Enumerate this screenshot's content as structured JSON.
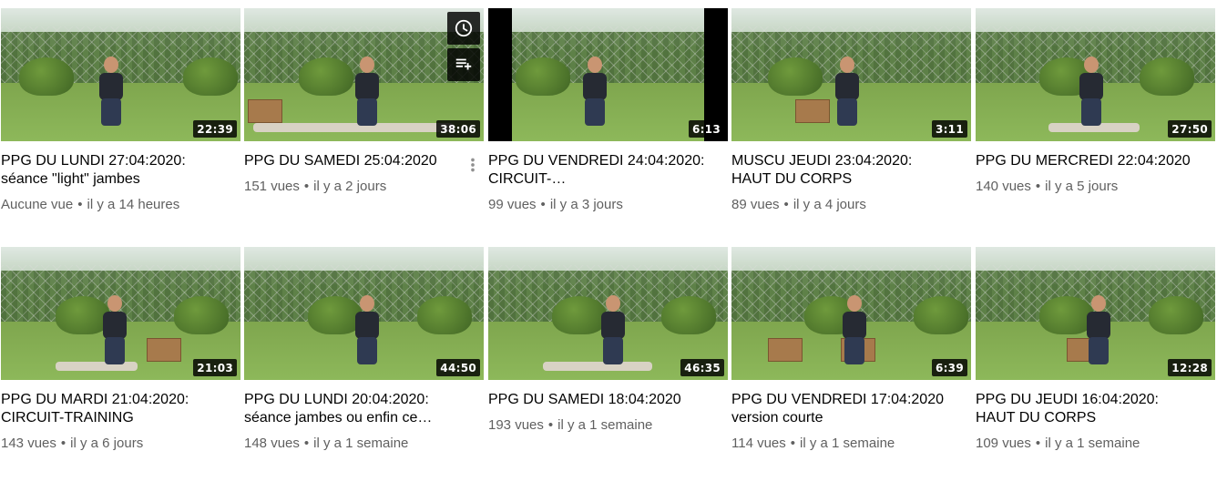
{
  "videos": [
    {
      "title": "PPG DU LUNDI 27:04:2020: séance \"light\" jambes",
      "views": "Aucune vue",
      "age": "il y a 14 heures",
      "duration": "22:39"
    },
    {
      "title": "PPG DU SAMEDI 25:04:2020",
      "views": "151 vues",
      "age": "il y a 2 jours",
      "duration": "38:06"
    },
    {
      "title": "PPG DU VENDREDI 24:04:2020: CIRCUIT-…",
      "views": "99 vues",
      "age": "il y a 3 jours",
      "duration": "6:13"
    },
    {
      "title": "MUSCU JEUDI 23:04:2020: HAUT DU CORPS",
      "views": "89 vues",
      "age": "il y a 4 jours",
      "duration": "3:11"
    },
    {
      "title": "PPG DU MERCREDI 22:04:2020",
      "views": "140 vues",
      "age": "il y a 5 jours",
      "duration": "27:50"
    },
    {
      "title": "PPG DU MARDI 21:04:2020: CIRCUIT-TRAINING",
      "views": "143 vues",
      "age": "il y a 6 jours",
      "duration": "21:03"
    },
    {
      "title": "PPG DU LUNDI 20:04:2020: séance jambes ou enfin ce…",
      "views": "148 vues",
      "age": "il y a 1 semaine",
      "duration": "44:50"
    },
    {
      "title": "PPG DU SAMEDI 18:04:2020",
      "views": "193 vues",
      "age": "il y a 1 semaine",
      "duration": "46:35"
    },
    {
      "title": "PPG DU VENDREDI 17:04:2020 version courte",
      "views": "114 vues",
      "age": "il y a 1 semaine",
      "duration": "6:39"
    },
    {
      "title": "PPG DU JEUDI 16:04:2020: HAUT DU CORPS",
      "views": "109 vues",
      "age": "il y a 1 semaine",
      "duration": "12:28"
    }
  ],
  "separator": "•",
  "hovered_index": 1,
  "hover_icons": [
    "clock-icon",
    "add-to-queue-icon",
    "more-vert-icon"
  ],
  "colors": {
    "duration_bg": "#000000cc",
    "meta_text": "#606060",
    "title_text": "#030303"
  }
}
